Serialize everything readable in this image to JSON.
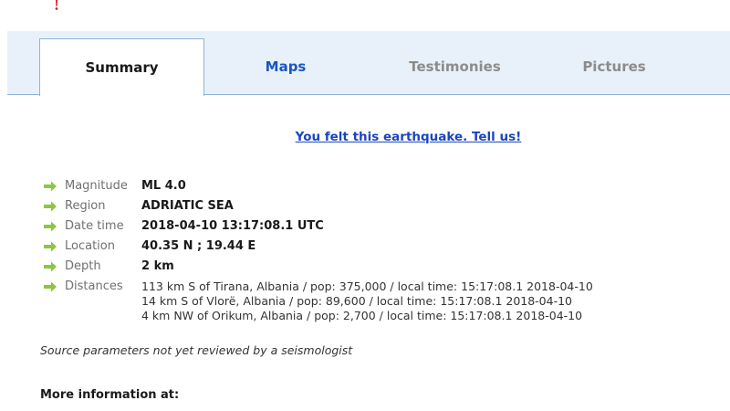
{
  "tabs": {
    "summary": "Summary",
    "maps": "Maps",
    "testimonies": "Testimonies",
    "pictures": "Pictures",
    "active": "Summary"
  },
  "felt_link": "You felt this earthquake. Tell us!",
  "details": {
    "magnitude": {
      "label": "Magnitude",
      "value": "ML 4.0"
    },
    "region": {
      "label": "Region",
      "value": "ADRIATIC SEA"
    },
    "datetime": {
      "label": "Date time",
      "value": "2018-04-10 13:17:08.1 UTC"
    },
    "location": {
      "label": "Location",
      "value": "40.35 N ; 19.44 E"
    },
    "depth": {
      "label": "Depth",
      "value": "2 km"
    },
    "distances": {
      "label": "Distances",
      "items": [
        "113 km S of Tirana, Albania / pop: 375,000 / local time: 15:17:08.1 2018-04-10",
        "14 km S of Vlorë, Albania / pop: 89,600 / local time: 15:17:08.1 2018-04-10",
        "4 km NW of Orikum, Albania / pop: 2,700 / local time: 15:17:08.1 2018-04-10"
      ]
    }
  },
  "review_note": "Source parameters not yet reviewed by a seismologist",
  "more_info_label": "More information at:",
  "colors": {
    "tab_bar_bg": "#e8f1fa",
    "tab_border": "#8fb4d6",
    "link_blue": "#1a45c0",
    "arrow_green": "#8dc63f",
    "label_gray": "#707070"
  },
  "icons": {
    "bullet": "green-right-arrow-icon",
    "logo": "red-pin-icon"
  }
}
